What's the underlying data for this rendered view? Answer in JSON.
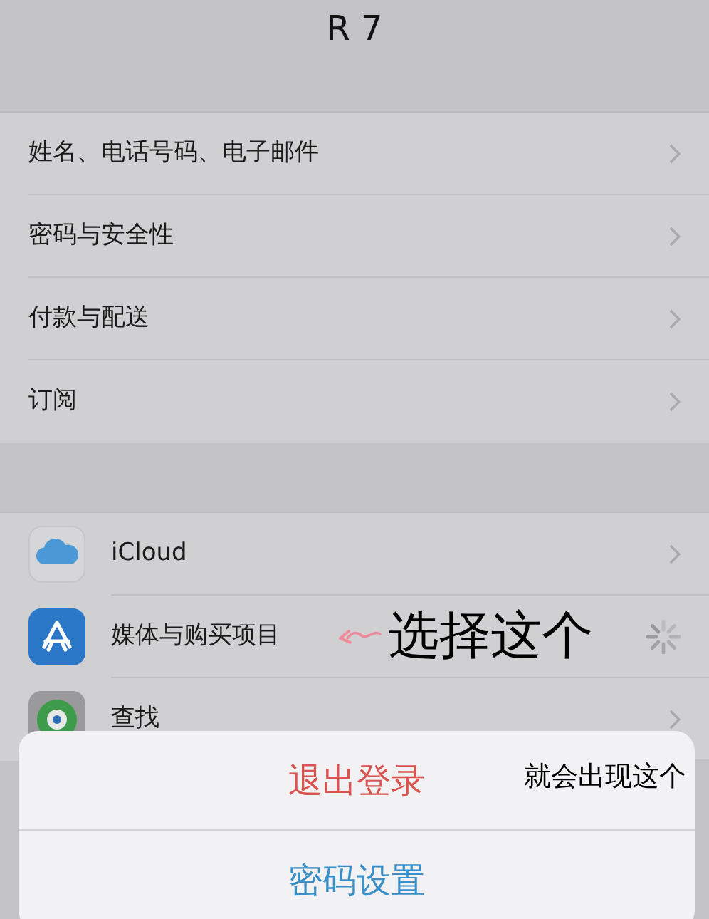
{
  "header": {
    "title": "R 7"
  },
  "account_rows": [
    {
      "label": "姓名、电话号码、电子邮件"
    },
    {
      "label": "密码与安全性"
    },
    {
      "label": "付款与配送"
    },
    {
      "label": "订阅"
    }
  ],
  "service_rows": [
    {
      "label": "iCloud",
      "loading": false
    },
    {
      "label": "媒体与购买项目",
      "loading": true,
      "annotation": "选择这个"
    },
    {
      "label": "查找",
      "loading": false
    }
  ],
  "action_sheet": {
    "annotation": "就会出现这个",
    "actions": [
      {
        "label": "退出登录",
        "kind": "destructive"
      },
      {
        "label": "密码设置",
        "kind": "default"
      }
    ]
  }
}
